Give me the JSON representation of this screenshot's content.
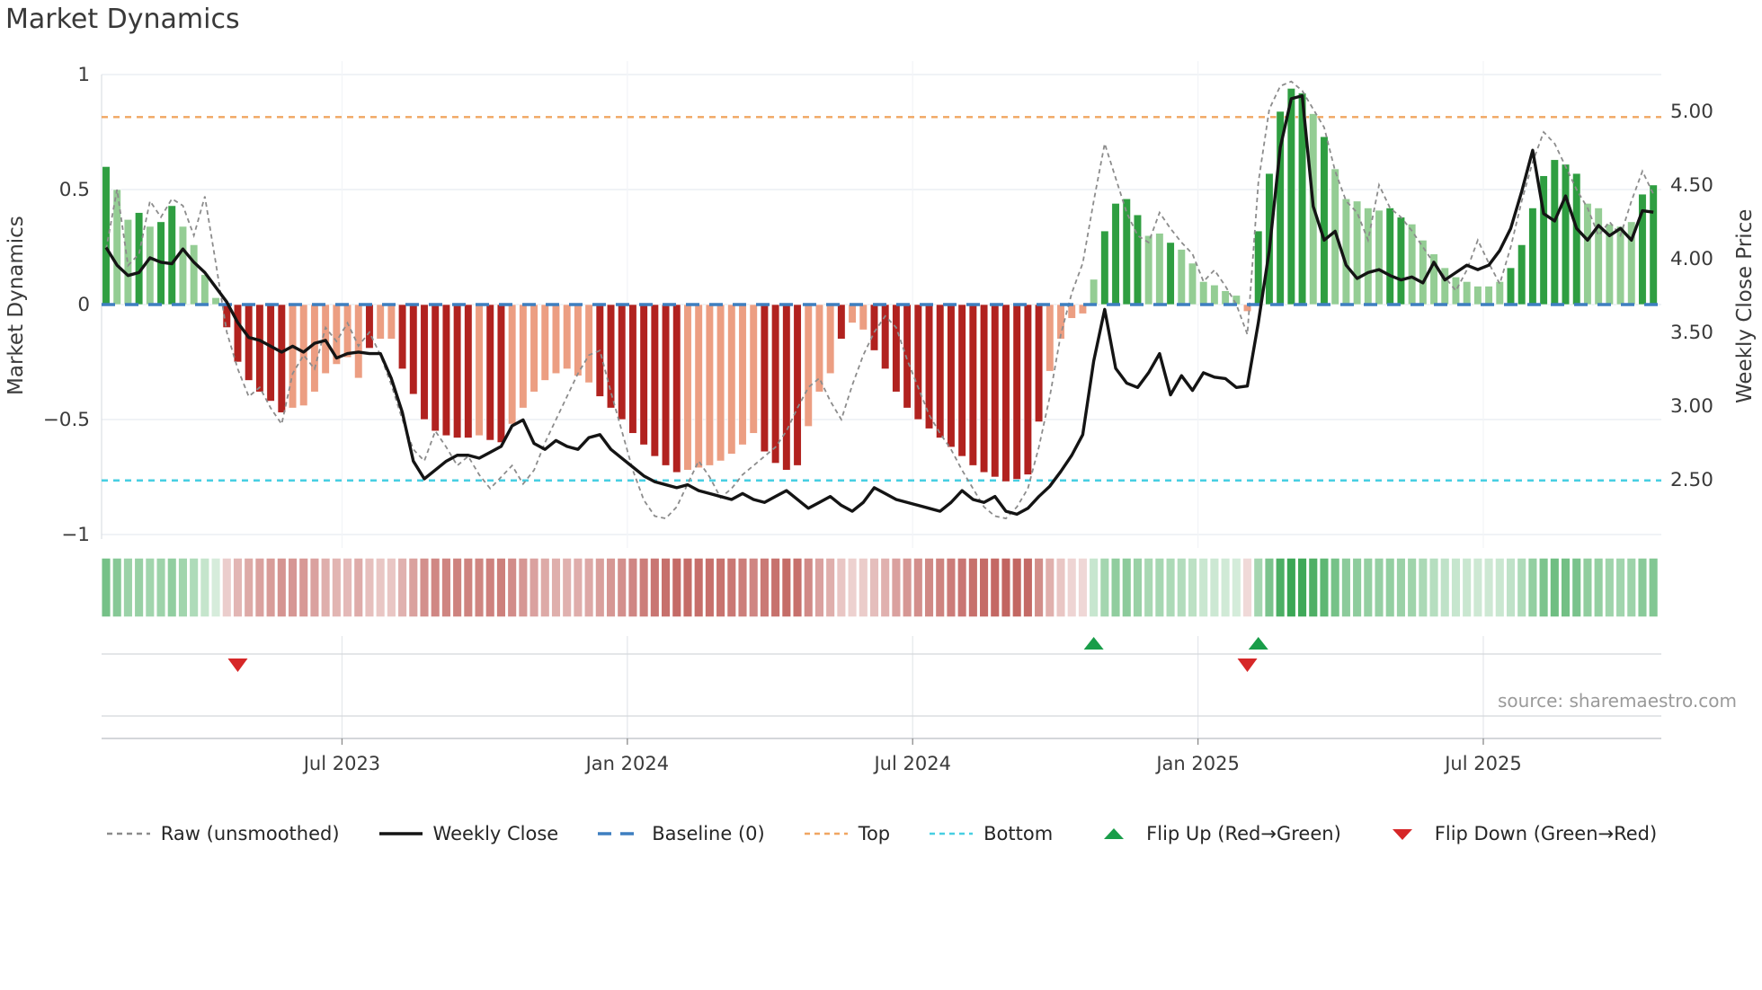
{
  "title": "Market Dynamics",
  "source": "source: sharemaestro.com",
  "left_axis": {
    "label": "Market Dynamics",
    "tick_labels": [
      "1",
      "0.5",
      "0",
      "−0.5",
      "−1"
    ],
    "tick_values": [
      1,
      0.5,
      0,
      -0.5,
      -1
    ]
  },
  "right_axis": {
    "label": "Weekly Close Price",
    "tick_labels": [
      "5.00",
      "4.50",
      "4.00",
      "3.50",
      "3.00",
      "2.50"
    ],
    "tick_values": [
      5.0,
      4.5,
      4.0,
      3.5,
      3.0,
      2.5
    ]
  },
  "x_axis": {
    "tick_labels": [
      "Jul 2023",
      "Jan 2024",
      "Jul 2024",
      "Jan 2025",
      "Jul 2025"
    ],
    "tick_weeks": [
      21.5,
      47.5,
      73.5,
      99.5,
      125.5
    ]
  },
  "legend": {
    "items": [
      {
        "label": "Raw (unsmoothed)",
        "glyph": "dashed-line",
        "color": "#8c8c8c"
      },
      {
        "label": "Weekly Close",
        "glyph": "solid-line",
        "color": "#141414"
      },
      {
        "label": "Baseline (0)",
        "glyph": "long-dash-line",
        "color": "#3e7fc0"
      },
      {
        "label": "Top",
        "glyph": "short-dash-line",
        "color": "#f0a661"
      },
      {
        "label": "Bottom",
        "glyph": "short-dash-line",
        "color": "#48cfe2"
      },
      {
        "label": "Flip Up (Red→Green)",
        "glyph": "triangle-up",
        "color": "#199d49"
      },
      {
        "label": "Flip Down (Green→Red)",
        "glyph": "triangle-down",
        "color": "#d62728"
      }
    ]
  },
  "colors": {
    "bar_green_dark": "#2f9e41",
    "bar_green_light": "#94cd94",
    "bar_red_dark": "#b1221f",
    "bar_red_light": "#ec9e82",
    "baseline_blue": "#3e7fc0",
    "top_orange": "#f0a661",
    "bottom_cyan": "#48cfe2",
    "raw_gray": "#8c8c8c",
    "price_black": "#141414",
    "flip_up_green": "#199d49",
    "flip_down_red": "#d62728",
    "grid": "#e8ecf1",
    "grid_faint": "#f2f4f7",
    "band_line": "#d4d7db",
    "axis_line": "#c6c9cd",
    "heat_green": [
      26,
      152,
      56
    ],
    "heat_red": [
      172,
      44,
      38
    ]
  },
  "chart_data": {
    "type": "combo (bar oscillator + line price + heatmap strip + flip markers)",
    "weeks": 142,
    "x_range_note": "weekly points, Feb 2023 - Oct 2025",
    "ylim_left": [
      -1.06,
      1.06
    ],
    "ylim_right_ticks": [
      5.0,
      4.5,
      4.0,
      3.5,
      3.0,
      2.5
    ],
    "reference_lines": {
      "baseline": 0,
      "top": 0.815,
      "bottom": -0.765
    },
    "grid": "on",
    "legend_position": "bottom center",
    "oscillator": [
      0.6,
      0.5,
      0.37,
      0.4,
      0.34,
      0.36,
      0.43,
      0.34,
      0.26,
      0.13,
      0.03,
      -0.1,
      -0.25,
      -0.33,
      -0.38,
      -0.42,
      -0.47,
      -0.45,
      -0.44,
      -0.38,
      -0.3,
      -0.26,
      -0.23,
      -0.32,
      -0.19,
      -0.15,
      -0.15,
      -0.28,
      -0.39,
      -0.5,
      -0.55,
      -0.57,
      -0.58,
      -0.58,
      -0.57,
      -0.59,
      -0.6,
      -0.52,
      -0.45,
      -0.38,
      -0.33,
      -0.3,
      -0.28,
      -0.31,
      -0.34,
      -0.4,
      -0.45,
      -0.5,
      -0.56,
      -0.61,
      -0.66,
      -0.7,
      -0.73,
      -0.72,
      -0.71,
      -0.7,
      -0.68,
      -0.65,
      -0.61,
      -0.56,
      -0.64,
      -0.69,
      -0.72,
      -0.7,
      -0.53,
      -0.38,
      -0.3,
      -0.15,
      -0.08,
      -0.11,
      -0.2,
      -0.28,
      -0.38,
      -0.45,
      -0.5,
      -0.54,
      -0.58,
      -0.62,
      -0.66,
      -0.7,
      -0.73,
      -0.75,
      -0.77,
      -0.76,
      -0.74,
      -0.51,
      -0.29,
      -0.15,
      -0.06,
      -0.04,
      0.11,
      0.32,
      0.44,
      0.46,
      0.39,
      0.3,
      0.31,
      0.27,
      0.24,
      0.18,
      0.1,
      0.085,
      0.06,
      0.04,
      -0.03,
      0.32,
      0.57,
      0.84,
      0.94,
      0.92,
      0.83,
      0.73,
      0.59,
      0.46,
      0.45,
      0.42,
      0.41,
      0.42,
      0.38,
      0.35,
      0.28,
      0.22,
      0.16,
      0.12,
      0.1,
      0.08,
      0.08,
      0.1,
      0.16,
      0.26,
      0.42,
      0.56,
      0.63,
      0.61,
      0.57,
      0.44,
      0.42,
      0.35,
      0.34,
      0.36,
      0.48,
      0.52
    ],
    "bar_tone": "dlldlddllllddddddllllllldlldddddddlddllllllllddddddddlllllllddddllldllddddddddddddddddlllllddddlldllllllldddddldlllllddllllllllldddddddlllllddd",
    "raw": [
      0.24,
      0.5,
      0.17,
      0.22,
      0.45,
      0.38,
      0.46,
      0.43,
      0.3,
      0.47,
      0.18,
      -0.12,
      -0.28,
      -0.4,
      -0.36,
      -0.45,
      -0.52,
      -0.3,
      -0.22,
      -0.28,
      -0.1,
      -0.16,
      -0.08,
      -0.18,
      -0.12,
      -0.22,
      -0.35,
      -0.5,
      -0.63,
      -0.68,
      -0.55,
      -0.62,
      -0.7,
      -0.66,
      -0.74,
      -0.8,
      -0.75,
      -0.7,
      -0.78,
      -0.72,
      -0.6,
      -0.5,
      -0.4,
      -0.3,
      -0.22,
      -0.2,
      -0.38,
      -0.55,
      -0.72,
      -0.85,
      -0.92,
      -0.93,
      -0.88,
      -0.78,
      -0.68,
      -0.75,
      -0.84,
      -0.8,
      -0.74,
      -0.7,
      -0.66,
      -0.62,
      -0.55,
      -0.45,
      -0.36,
      -0.32,
      -0.42,
      -0.5,
      -0.35,
      -0.22,
      -0.12,
      -0.05,
      -0.1,
      -0.24,
      -0.36,
      -0.48,
      -0.56,
      -0.63,
      -0.72,
      -0.8,
      -0.88,
      -0.92,
      -0.93,
      -0.88,
      -0.8,
      -0.62,
      -0.4,
      -0.13,
      0.05,
      0.18,
      0.45,
      0.7,
      0.55,
      0.4,
      0.3,
      0.27,
      0.4,
      0.33,
      0.27,
      0.22,
      0.1,
      0.15,
      0.08,
      0.0,
      -0.13,
      0.53,
      0.85,
      0.95,
      0.97,
      0.93,
      0.85,
      0.77,
      0.58,
      0.45,
      0.4,
      0.28,
      0.52,
      0.42,
      0.38,
      0.32,
      0.25,
      0.18,
      0.12,
      0.06,
      0.15,
      0.28,
      0.18,
      0.09,
      0.25,
      0.45,
      0.62,
      0.75,
      0.7,
      0.6,
      0.5,
      0.42,
      0.3,
      0.36,
      0.3,
      0.45,
      0.58,
      0.48
    ],
    "price": [
      4.07,
      3.95,
      3.88,
      3.9,
      4.0,
      3.97,
      3.96,
      4.06,
      3.97,
      3.9,
      3.8,
      3.7,
      3.56,
      3.46,
      3.44,
      3.4,
      3.36,
      3.4,
      3.36,
      3.42,
      3.44,
      3.32,
      3.35,
      3.36,
      3.35,
      3.35,
      3.18,
      2.95,
      2.62,
      2.5,
      2.56,
      2.62,
      2.66,
      2.66,
      2.64,
      2.68,
      2.72,
      2.86,
      2.9,
      2.74,
      2.7,
      2.76,
      2.72,
      2.7,
      2.78,
      2.8,
      2.7,
      2.64,
      2.58,
      2.52,
      2.48,
      2.46,
      2.44,
      2.46,
      2.42,
      2.4,
      2.38,
      2.36,
      2.4,
      2.36,
      2.34,
      2.38,
      2.42,
      2.36,
      2.3,
      2.34,
      2.38,
      2.32,
      2.28,
      2.34,
      2.44,
      2.4,
      2.36,
      2.34,
      2.32,
      2.3,
      2.28,
      2.34,
      2.42,
      2.36,
      2.34,
      2.38,
      2.28,
      2.26,
      2.3,
      2.38,
      2.45,
      2.55,
      2.66,
      2.8,
      3.3,
      3.65,
      3.25,
      3.15,
      3.12,
      3.22,
      3.35,
      3.07,
      3.2,
      3.1,
      3.22,
      3.19,
      3.18,
      3.12,
      3.13,
      3.56,
      4.05,
      4.75,
      5.08,
      5.1,
      4.35,
      4.12,
      4.18,
      3.95,
      3.86,
      3.9,
      3.92,
      3.88,
      3.85,
      3.87,
      3.83,
      3.97,
      3.85,
      3.9,
      3.95,
      3.92,
      3.95,
      4.05,
      4.2,
      4.45,
      4.73,
      4.3,
      4.25,
      4.42,
      4.2,
      4.12,
      4.22,
      4.15,
      4.2,
      4.12,
      4.32,
      4.31
    ],
    "flip_up_weeks": [
      90,
      105
    ],
    "flip_down_weeks": [
      12,
      104
    ]
  }
}
